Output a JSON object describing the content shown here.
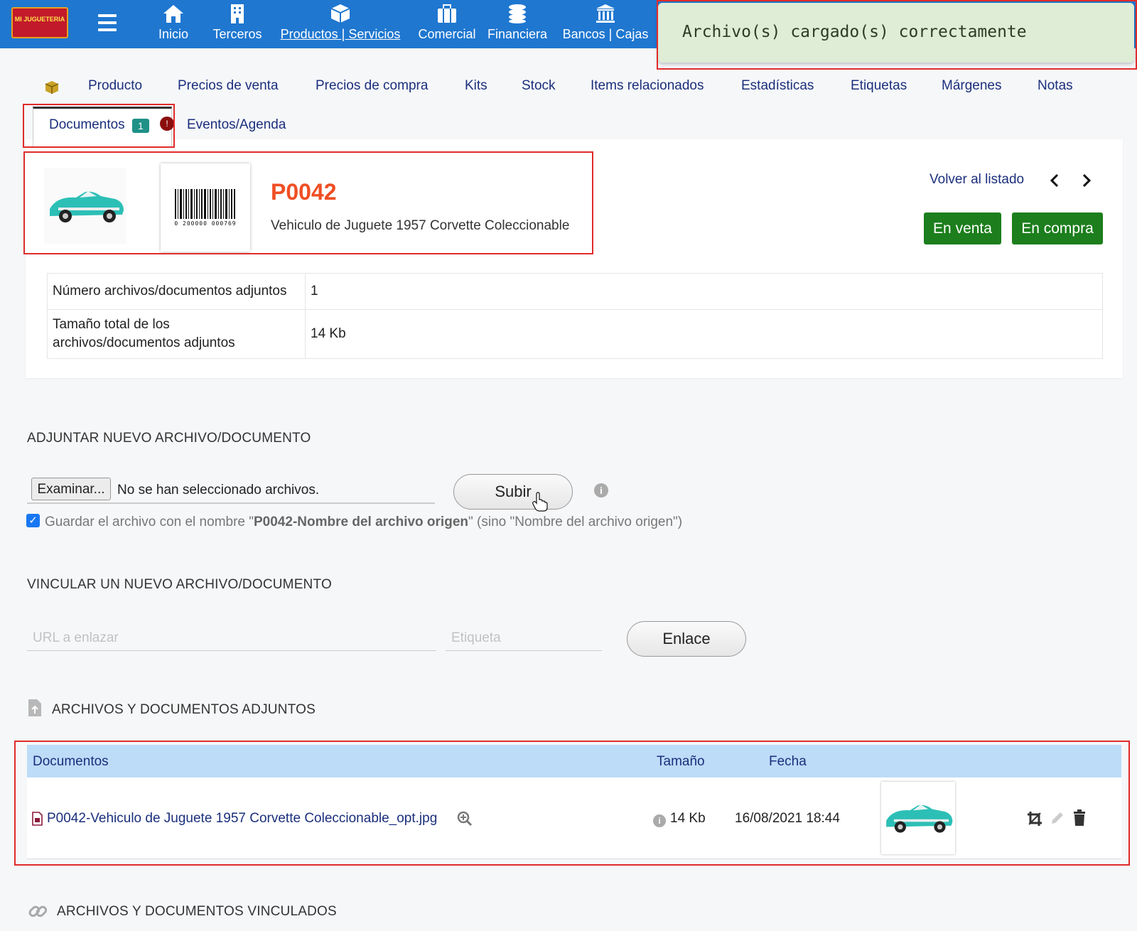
{
  "app": {
    "logo_text": "MI JUGUETERIA"
  },
  "nav": [
    {
      "label": "Inicio",
      "icon": "home-icon"
    },
    {
      "label": "Terceros",
      "icon": "building-icon"
    },
    {
      "label": "Productos | Servicios",
      "icon": "box-icon"
    },
    {
      "label": "Comercial",
      "icon": "briefcase-icon"
    },
    {
      "label": "Financiera",
      "icon": "coins-icon"
    },
    {
      "label": "Bancos | Cajas",
      "icon": "bank-icon"
    }
  ],
  "toast": {
    "message": "Archivo(s) cargado(s) correctamente"
  },
  "subtabs": [
    "Producto",
    "Precios de venta",
    "Precios de compra",
    "Kits",
    "Stock",
    "Items relacionados",
    "Estadísticas",
    "Etiquetas",
    "Márgenes",
    "Notas"
  ],
  "tabs2": {
    "documents": "Documentos",
    "documents_count": "1",
    "warning": "!",
    "events": "Eventos/Agenda"
  },
  "product": {
    "ref": "P0042",
    "label": "Vehiculo de Juguete 1957 Corvette Coleccionable",
    "barcode_text": "0 200000 000769",
    "back_link": "Volver al listado",
    "status_sell": "En venta",
    "status_buy": "En compra"
  },
  "info": {
    "count_label": "Número archivos/documentos adjuntos",
    "count_value": "1",
    "size_label_1": "Tamaño total de los",
    "size_label_2": "archivos/documentos adjuntos",
    "size_value": "14 Kb"
  },
  "attach": {
    "title": "ADJUNTAR NUEVO ARCHIVO/DOCUMENTO",
    "browse": "Examinar...",
    "no_file": "No se han seleccionado archivos.",
    "upload": "Subir",
    "checkbox_pre": "Guardar el archivo con el nombre \"",
    "checkbox_bold": "P0042-Nombre del archivo origen",
    "checkbox_post": "\" (sino \"Nombre del archivo origen\")"
  },
  "link": {
    "title": "VINCULAR UN NUEVO ARCHIVO/DOCUMENTO",
    "url_placeholder": "URL a enlazar",
    "label_placeholder": "Etiqueta",
    "button": "Enlace"
  },
  "attached": {
    "title": "ARCHIVOS Y DOCUMENTOS ADJUNTOS",
    "col_docs": "Documentos",
    "col_size": "Tamaño",
    "col_date": "Fecha",
    "rows": [
      {
        "name": "P0042-Vehiculo de Juguete 1957 Corvette Coleccionable_opt.jpg",
        "size": "14 Kb",
        "date": "16/08/2021 18:44"
      }
    ]
  },
  "linked": {
    "title": "ARCHIVOS Y DOCUMENTOS VINCULADOS"
  },
  "colors": {
    "nav_bg": "#1f77d0",
    "ref_color": "#f04e23",
    "status_green": "#1c7e1c",
    "link_blue": "#1b2f7c",
    "highlight": "#e02b2b"
  }
}
